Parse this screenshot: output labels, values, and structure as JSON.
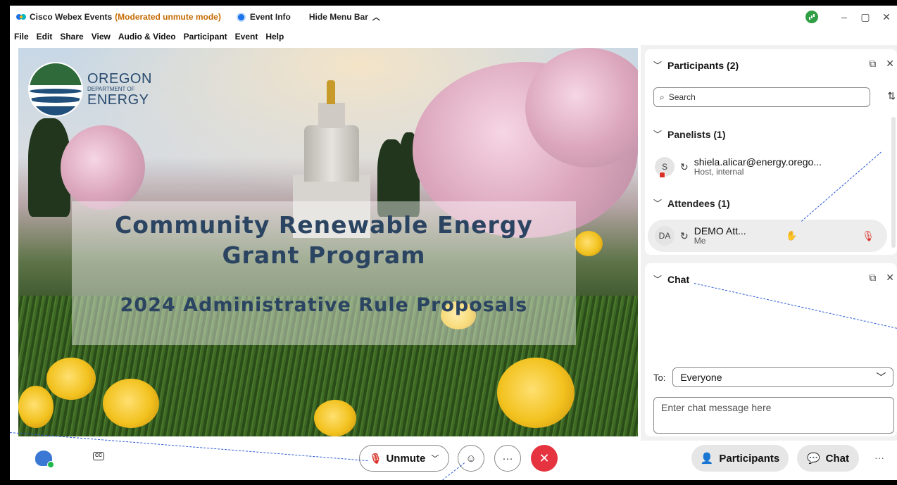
{
  "titlebar": {
    "app_title": "Cisco Webex Events",
    "mode": "(Moderated unmute mode)",
    "event_info": "Event Info",
    "hide_menu": "Hide Menu Bar",
    "minimize": "–",
    "restore": "▢",
    "close": "✕"
  },
  "menu": [
    "File",
    "Edit",
    "Share",
    "View",
    "Audio & Video",
    "Participant",
    "Event",
    "Help"
  ],
  "slide": {
    "logo_line1": "OREGON",
    "logo_line2": "DEPARTMENT OF",
    "logo_line3": "ENERGY",
    "title_line1": "Community Renewable Energy",
    "title_line2": "Grant Program",
    "subtitle": "2024 Administrative Rule Proposals"
  },
  "participants": {
    "header": "Participants (2)",
    "search_placeholder": "Search",
    "panelists_header": "Panelists (1)",
    "panelist": {
      "avatar": "S",
      "name": "shiela.alicar@energy.orego...",
      "role": "Host, internal"
    },
    "attendees_header": "Attendees (1)",
    "attendee": {
      "avatar": "DA",
      "name": "DEMO Att...",
      "role": "Me"
    }
  },
  "chat": {
    "header": "Chat",
    "to_label": "To:",
    "to_value": "Everyone",
    "input_placeholder": "Enter chat message here"
  },
  "controls": {
    "cc_label": "CC",
    "unmute_label": "Unmute",
    "more_label": "···",
    "end_label": "✕",
    "participants_label": "Participants",
    "chat_label": "Chat",
    "more_right": "···"
  },
  "colors": {
    "mode_text": "#c66a00",
    "end_button": "#e5333f",
    "mic_muted": "#d93025",
    "annotation_line": "#2b5bd7"
  }
}
